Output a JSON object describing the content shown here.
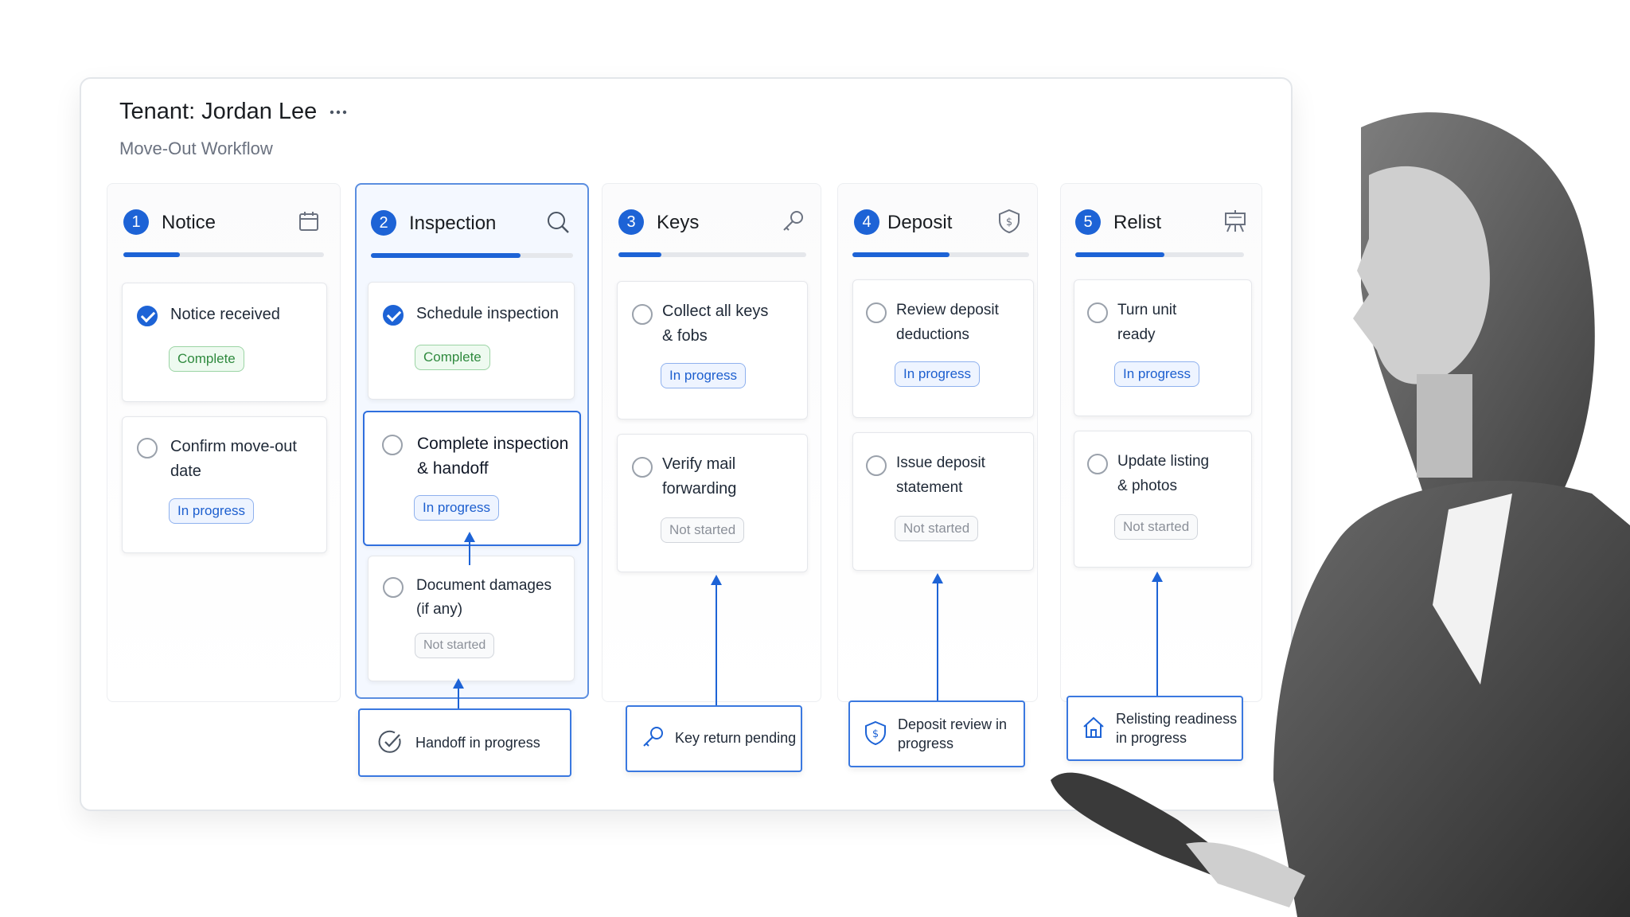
{
  "header": {
    "title": "Tenant: Jordan Lee",
    "subtitle": "Move-Out Workflow",
    "more_icon": "ellipsis-icon"
  },
  "columns": [
    {
      "number": "1",
      "title": "Notice",
      "icon": "calendar-icon",
      "progress": 0.28,
      "tasks": [
        {
          "text_l1": "Notice received",
          "text_l2": "",
          "status": "Complete",
          "done": true
        },
        {
          "text_l1": "Confirm move-out",
          "text_l2": "date",
          "status": "In progress",
          "done": false
        }
      ]
    },
    {
      "number": "2",
      "title": "Inspection",
      "icon": "search-icon",
      "progress": 0.74,
      "tasks": [
        {
          "text_l1": "Schedule inspection",
          "text_l2": "",
          "status": "Complete",
          "done": true
        },
        {
          "text_l1": "Complete inspection",
          "text_l2": "& handoff",
          "status": "In progress",
          "done": false
        },
        {
          "text_l1": "Document damages",
          "text_l2": "(if any)",
          "status": "Not started",
          "done": false
        }
      ]
    },
    {
      "number": "3",
      "title": "Keys",
      "icon": "key-icon",
      "progress": 0.23,
      "tasks": [
        {
          "text_l1": "Collect all keys",
          "text_l2": "& fobs",
          "status": "In progress",
          "done": false
        },
        {
          "text_l1": "Verify mail",
          "text_l2": "forwarding",
          "status": "Not started",
          "done": false
        }
      ]
    },
    {
      "number": "4",
      "title": "Deposit",
      "icon": "shield-dollar-icon",
      "progress": 0.55,
      "tasks": [
        {
          "text_l1": "Review deposit",
          "text_l2": "deductions",
          "status": "In progress",
          "done": false
        },
        {
          "text_l1": "Issue deposit",
          "text_l2": "statement",
          "status": "Not started",
          "done": false
        }
      ]
    },
    {
      "number": "5",
      "title": "Relist",
      "icon": "easel-icon",
      "progress": 0.53,
      "tasks": [
        {
          "text_l1": "Turn unit",
          "text_l2": "ready",
          "status": "In progress",
          "done": false
        },
        {
          "text_l1": "Update listing",
          "text_l2": "& photos",
          "status": "Not started",
          "done": false
        }
      ]
    }
  ],
  "callouts": [
    {
      "icon": "check-circle-icon",
      "text_l1": "Handoff in progress",
      "text_l2": ""
    },
    {
      "icon": "key-icon",
      "text_l1": "Key return pending",
      "text_l2": ""
    },
    {
      "icon": "shield-dollar-icon",
      "text_l1": "Deposit review in",
      "text_l2": "progress"
    },
    {
      "icon": "home-icon",
      "text_l1": "Relisting readiness",
      "text_l2": "in progress"
    }
  ],
  "colors": {
    "accent": "#1d63d6",
    "complete": "#2f8a3e",
    "in_progress": "#1d5fcf",
    "not_started": "#8b9099"
  }
}
